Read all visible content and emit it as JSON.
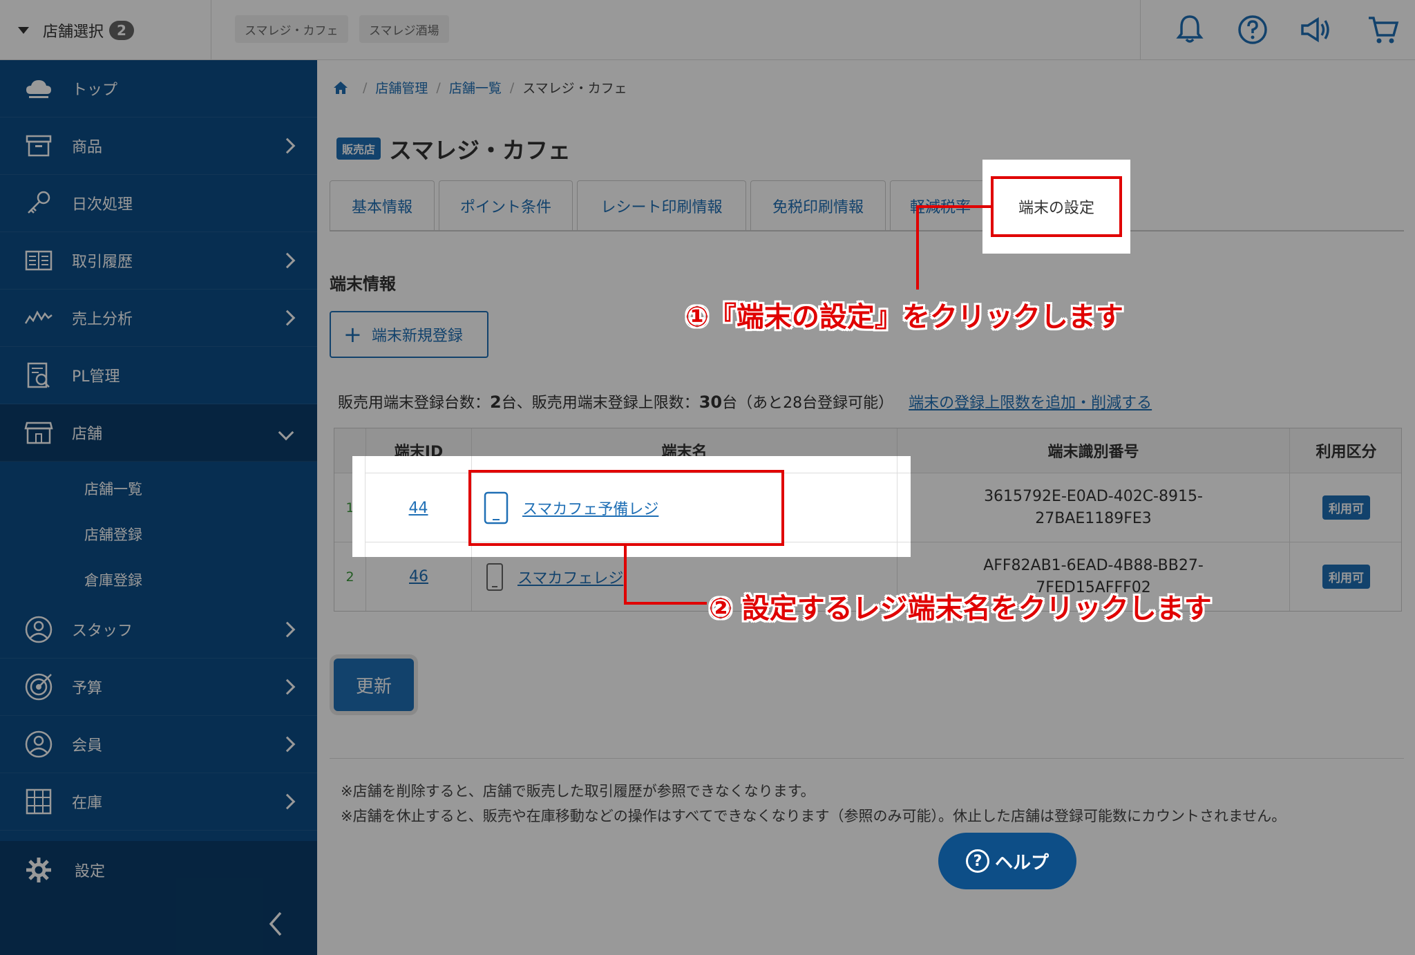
{
  "topbar": {
    "store_select_label": "店舗選択",
    "store_count": "2",
    "store_chips": [
      "スマレジ・カフェ",
      "スマレジ酒場"
    ],
    "icons": [
      "bell-icon",
      "help-circle-icon",
      "megaphone-icon",
      "cart-icon"
    ]
  },
  "sidebar": {
    "items": [
      {
        "label": "トップ",
        "icon": "cloud-icon"
      },
      {
        "label": "商品",
        "icon": "box-icon"
      },
      {
        "label": "日次処理",
        "icon": "key-icon"
      },
      {
        "label": "取引履歴",
        "icon": "ledger-icon"
      },
      {
        "label": "売上分析",
        "icon": "chart-icon"
      },
      {
        "label": "PL管理",
        "icon": "report-icon"
      },
      {
        "label": "店舗",
        "icon": "store-icon"
      },
      {
        "label": "スタッフ",
        "icon": "user-icon"
      },
      {
        "label": "予算",
        "icon": "target-icon"
      },
      {
        "label": "会員",
        "icon": "member-icon"
      },
      {
        "label": "在庫",
        "icon": "grid-icon"
      }
    ],
    "sub_items": [
      "店舗一覧",
      "店舗登録",
      "倉庫登録"
    ],
    "settings_label": "設定"
  },
  "breadcrumb": [
    "店舗管理",
    "店舗一覧",
    "スマレジ・カフェ"
  ],
  "page": {
    "badge": "販売店",
    "title": "スマレジ・カフェ"
  },
  "tabs": [
    "基本情報",
    "ポイント条件",
    "レシート印刷情報",
    "免税印刷情報",
    "軽減税率",
    "端末の設定"
  ],
  "section": {
    "title": "端末情報",
    "add_button": "端末新規登録",
    "count_prefix": "販売用端末登録台数：",
    "count_value": "2",
    "count_mid": "台、販売用端末登録上限数：",
    "limit_value": "30",
    "count_suffix": "台（あと28台登録可能）",
    "limit_link": "端末の登録上限数を追加・削減する"
  },
  "table": {
    "headers": [
      "端末ID",
      "端末名",
      "端末識別番号",
      "利用区分"
    ],
    "rows": [
      {
        "index": "1",
        "id": "44",
        "name": "スマカフェ予備レジ",
        "uuid1": "3615792E-E0AD-402C-8915-",
        "uuid2": "27BAE1189FE3",
        "status": "利用可"
      },
      {
        "index": "2",
        "id": "46",
        "name": "スマカフェレジ",
        "uuid1": "AFF82AB1-6EAD-4B88-BB27-",
        "uuid2": "7FED15AFFF02",
        "status": "利用可"
      }
    ]
  },
  "update_button": "更新",
  "notes": [
    "※店舗を削除すると、店舗で販売した取引履歴が参照できなくなります。",
    "※店舗を休止すると、販売や在庫移動などの操作はすべてできなくなります（参照のみ可能）。休止した店舗は登録可能数にカウントされません。"
  ],
  "help_button": "ヘルプ",
  "callouts": {
    "step1": "①『端末の設定』をクリックします",
    "step2": "② 設定するレジ端末名をクリックします"
  },
  "colors": {
    "accent": "#1f6fb5",
    "sidebar": "#0d4e87",
    "annotation": "#e00000"
  }
}
